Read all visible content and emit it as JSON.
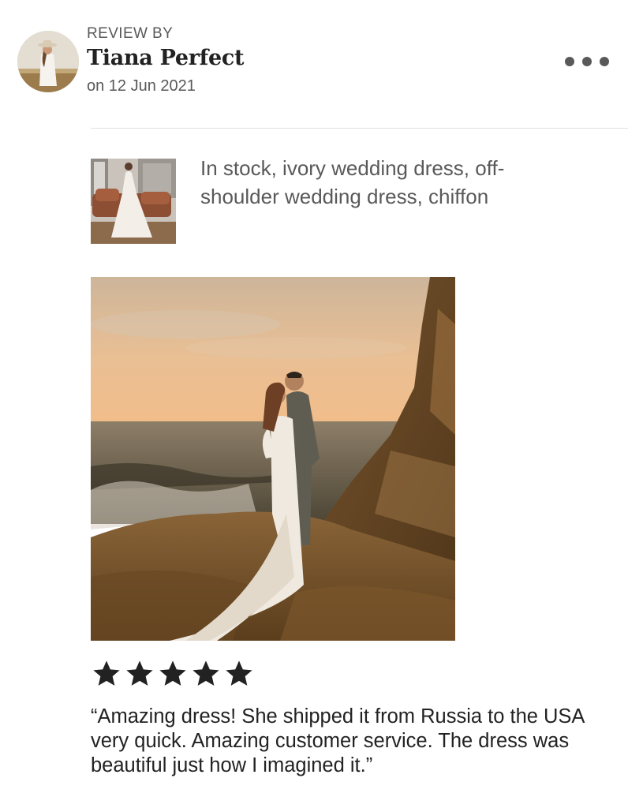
{
  "review": {
    "header_label": "REVIEW BY",
    "reviewer_name": "Tiana Perfect",
    "date": "on 12 Jun 2021",
    "more_icon": "more-horizontal-icon"
  },
  "listing": {
    "title": "In stock, ivory wedding dress, off-shoulder wedding dress, chiffon"
  },
  "rating": {
    "value": 5,
    "max": 5,
    "star_color": "#222222"
  },
  "review_text": "“Amazing dress! She shipped it from Russia to the USA very quick. Amazing customer service. The dress was beautiful just how I imagined it.”",
  "colors": {
    "primary_text": "#222222",
    "secondary_text": "#595959",
    "divider": "#e1e1e1"
  }
}
